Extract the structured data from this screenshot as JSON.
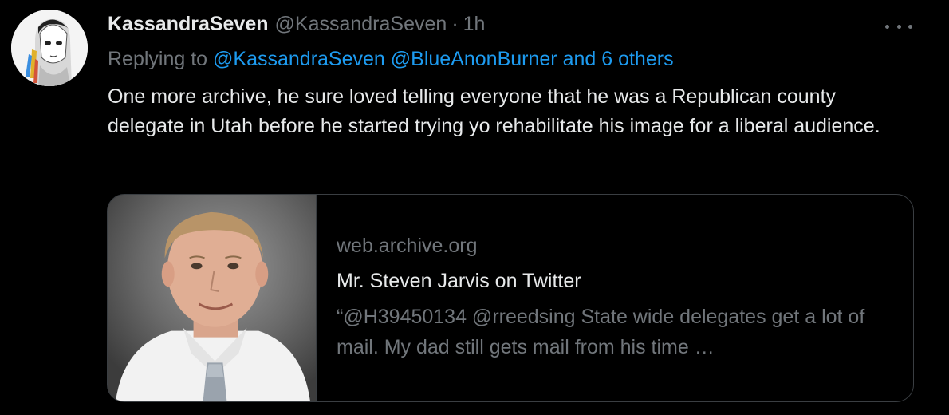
{
  "tweet": {
    "display_name": "KassandraSeven",
    "handle": "@KassandraSeven",
    "separator": "·",
    "time": "1h",
    "reply": {
      "prefix": "Replying to",
      "mention_1": "@KassandraSeven",
      "mention_2": "@BlueAnonBurner",
      "mention_3": "and 6 others"
    },
    "text": "One more archive, he sure loved telling everyone that he was a Republican county delegate in Utah before he started trying yo rehabilitate his image for a liberal audience.",
    "more_icon": "more-horizontal-icon"
  },
  "card": {
    "domain": "web.archive.org",
    "title": "Mr. Steven Jarvis on Twitter",
    "description": "“@H39450134 @rreedsing State wide delegates get a lot of mail. My dad still gets mail from his time …"
  },
  "colors": {
    "background": "#000000",
    "text_primary": "#e7e9ea",
    "text_secondary": "#71767b",
    "link": "#1d9bf0",
    "border": "#3a3e42"
  }
}
